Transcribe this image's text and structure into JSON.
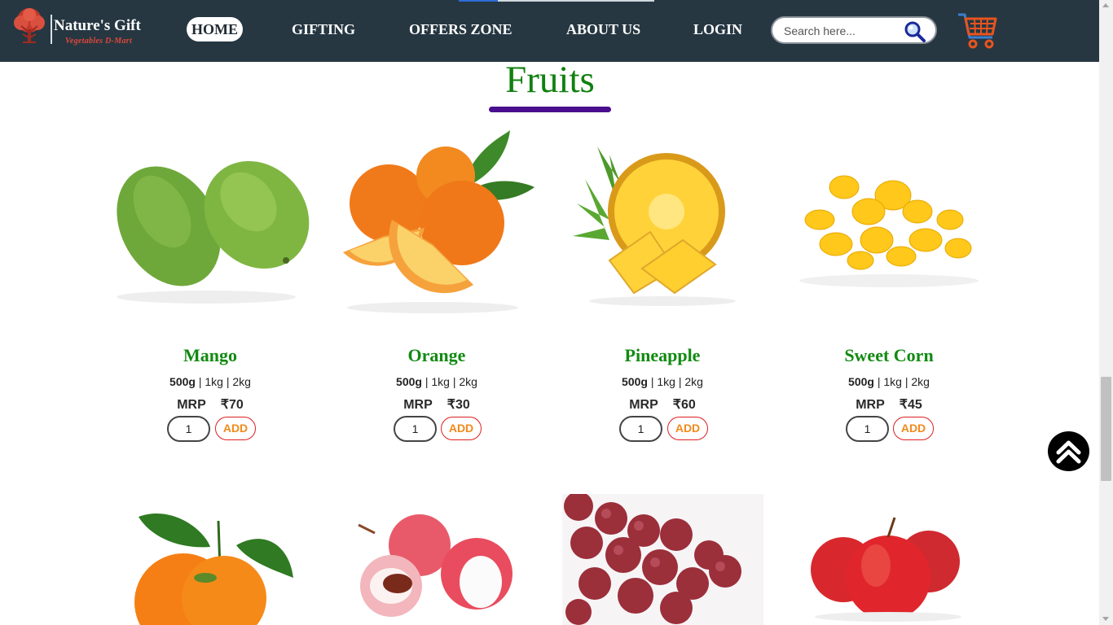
{
  "brand": {
    "name": "Nature's Gift",
    "tagline": "Vegetables D-Mart",
    "accent": "#e0473a"
  },
  "nav": {
    "items": [
      {
        "label": "HOME",
        "active": true
      },
      {
        "label": "GIFTING"
      },
      {
        "label": "OFFERS ZONE"
      },
      {
        "label": "ABOUT US"
      },
      {
        "label": "LOGIN"
      }
    ]
  },
  "search": {
    "placeholder": "Search here..."
  },
  "icons": {
    "search": "magnifier-icon",
    "cart": "shopping-cart-icon",
    "scroll_top": "double-chevron-up-icon"
  },
  "section": {
    "title": "Fruits"
  },
  "products": [
    {
      "name": "Mango",
      "weights": {
        "selected": "500g",
        "others": " | 1kg | 2kg"
      },
      "mrp_label": "MRP",
      "price": "₹70",
      "qty": "1",
      "add_label": "ADD"
    },
    {
      "name": "Orange",
      "weights": {
        "selected": "500g",
        "others": " | 1kg | 2kg"
      },
      "mrp_label": "MRP",
      "price": "₹30",
      "qty": "1",
      "add_label": "ADD"
    },
    {
      "name": "Pineapple",
      "weights": {
        "selected": "500g",
        "others": " | 1kg | 2kg"
      },
      "mrp_label": "MRP",
      "price": "₹60",
      "qty": "1",
      "add_label": "ADD"
    },
    {
      "name": "Sweet Corn",
      "weights": {
        "selected": "500g",
        "others": " | 1kg | 2kg"
      },
      "mrp_label": "MRP",
      "price": "₹45",
      "qty": "1",
      "add_label": "ADD"
    }
  ],
  "more_products": [
    "tangerine",
    "lychee",
    "grapes",
    "apple"
  ],
  "colors": {
    "header_bg": "#263742",
    "title_green": "#108010",
    "underline_purple": "#4a0f8c",
    "add_orange": "#f28a1a",
    "add_border": "#e02020"
  }
}
